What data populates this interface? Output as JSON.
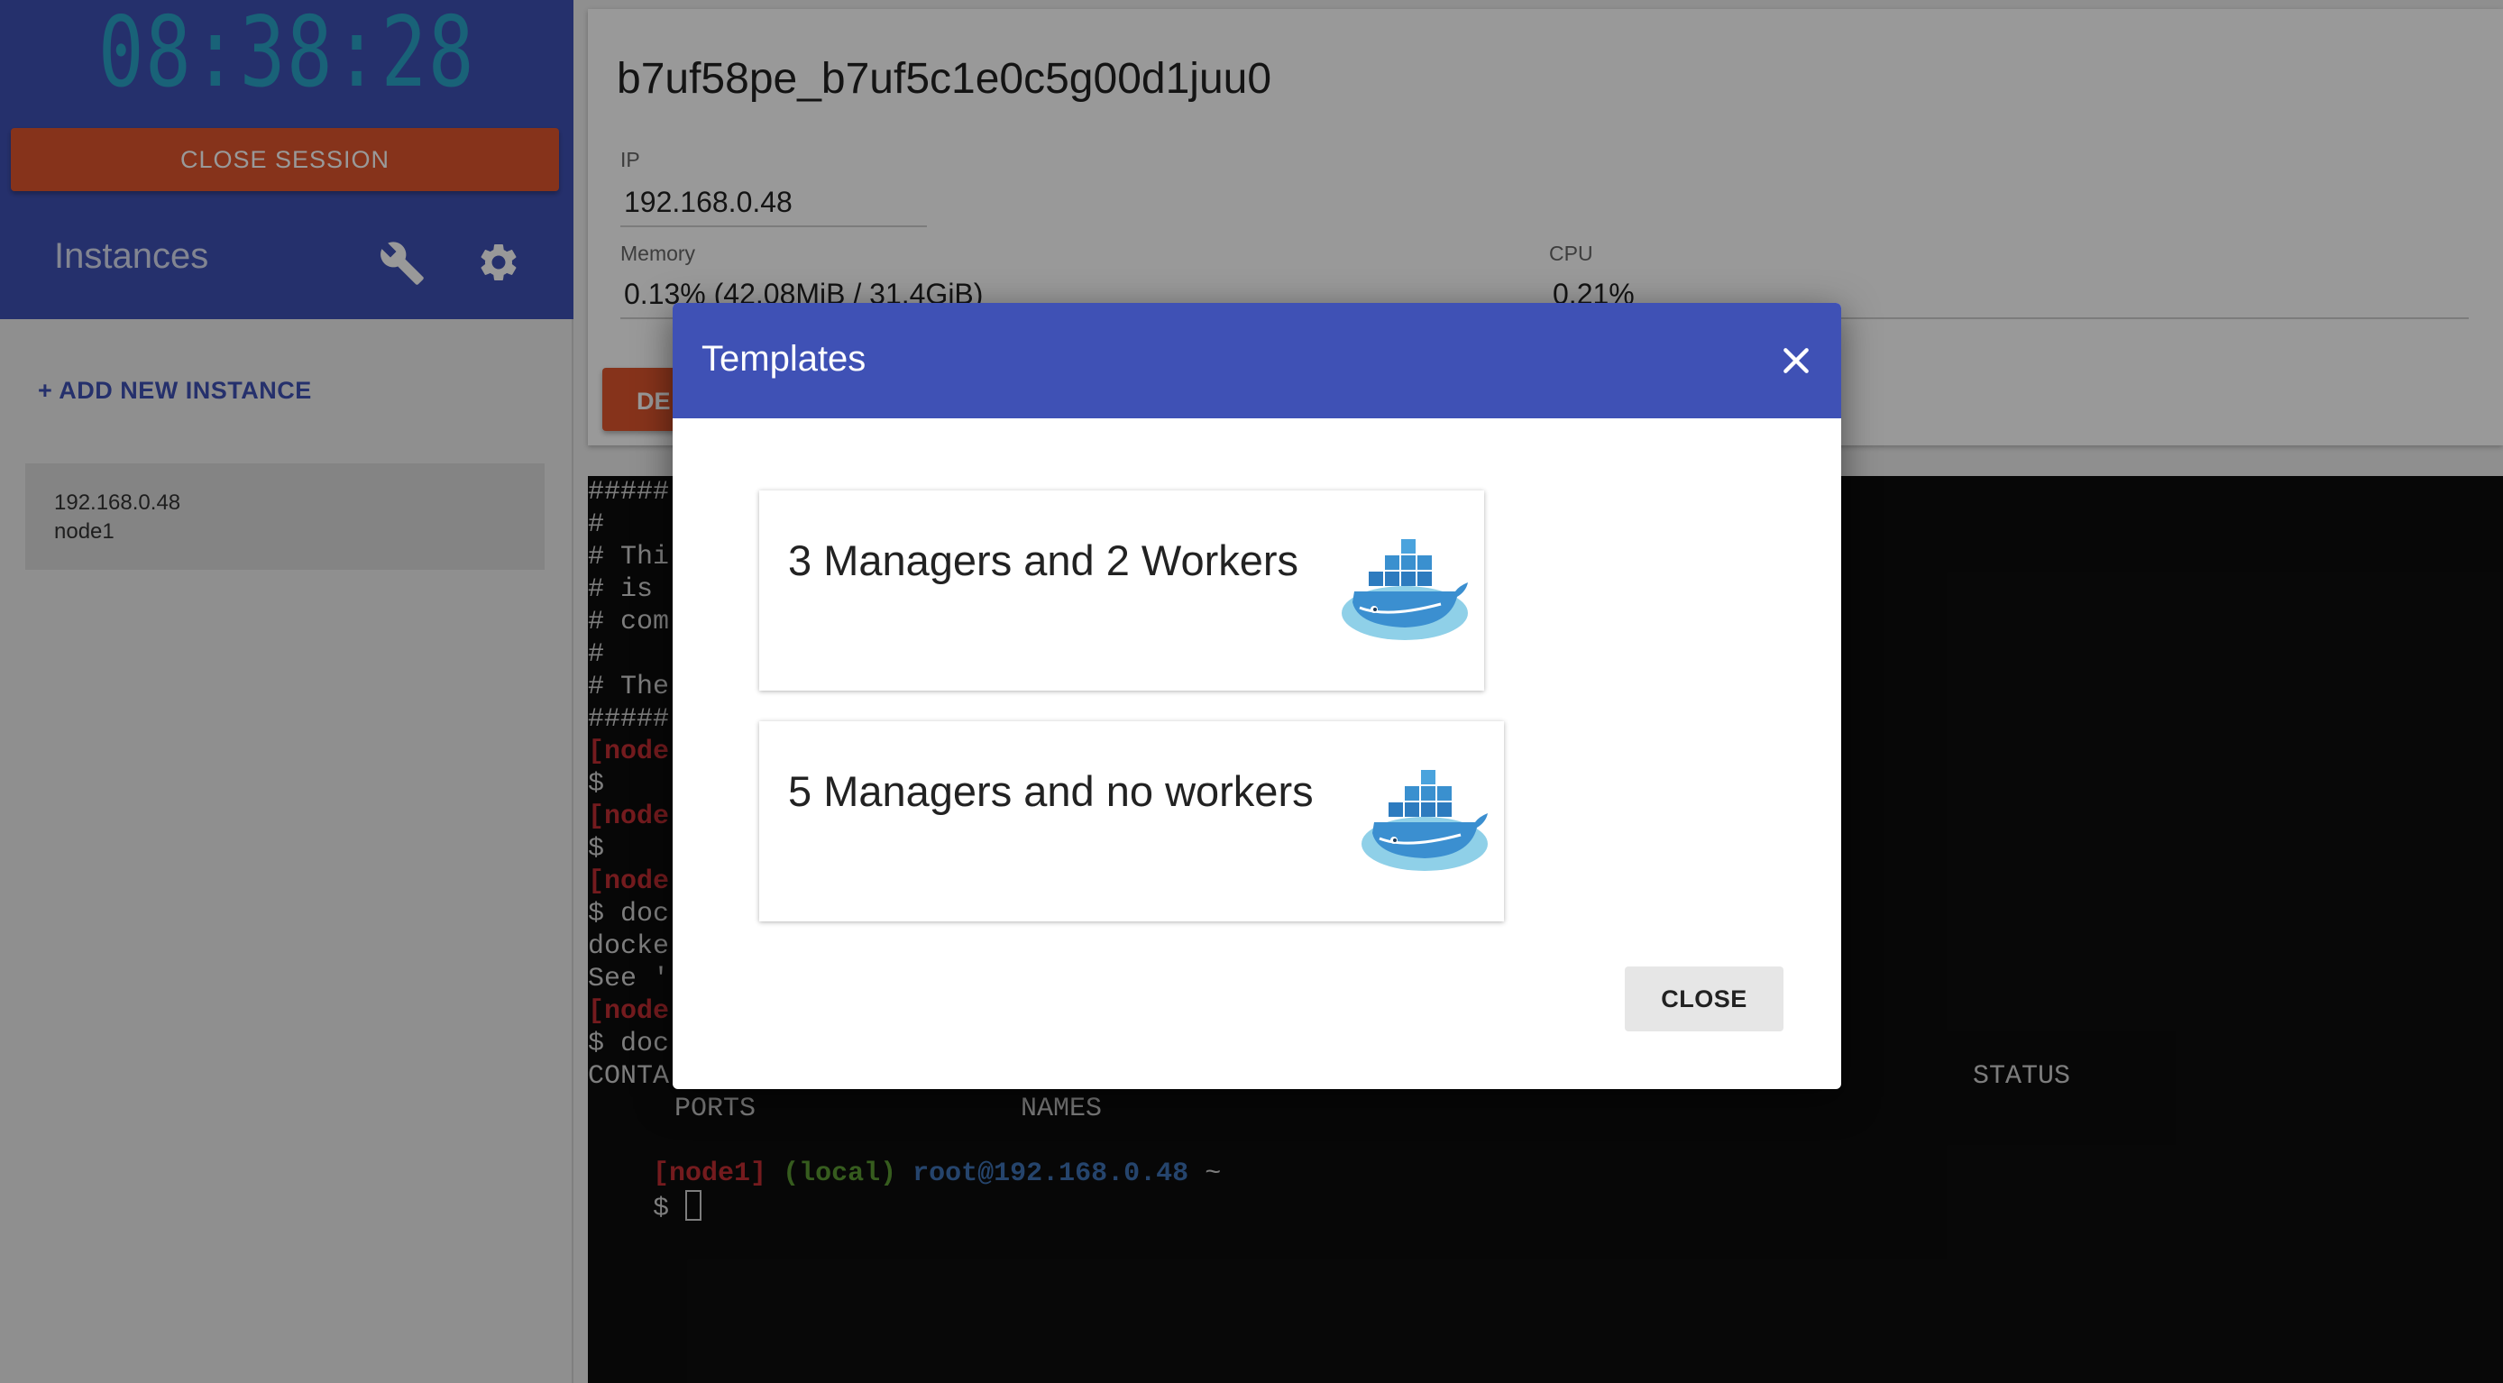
{
  "sidebar": {
    "clock": "08:38:28",
    "close_session_label": "CLOSE SESSION",
    "instances_title": "Instances",
    "add_instance_label": "+ ADD NEW INSTANCE",
    "instances": [
      {
        "ip": "192.168.0.48",
        "name": "node1"
      }
    ],
    "icons": [
      "wrench-icon",
      "gear-icon"
    ]
  },
  "instance_panel": {
    "title": "b7uf58pe_b7uf5c1e0c5g00d1juu0",
    "ip_label": "IP",
    "ip_value": "192.168.0.48",
    "memory_label": "Memory",
    "memory_value": "0.13% (42.08MiB / 31.4GiB)",
    "cpu_label": "CPU",
    "cpu_value": "0.21%",
    "delete_label_visible": "DE"
  },
  "terminal": {
    "lines": [
      "#####",
      "#",
      "# Thi",
      "# is",
      "# com",
      "#",
      "# The",
      "#####",
      "[node",
      "$",
      "[node",
      "$",
      "[node",
      "$ doc",
      "docke",
      "See '",
      "[node",
      "$ doc"
    ],
    "header_line_start": "CONTA",
    "header_status": "STATUS",
    "header_ports": "PORTS",
    "header_names": "NAMES",
    "prompt_host": "[node1]",
    "prompt_scope": "(local)",
    "prompt_user": "root@192.168.0.48",
    "prompt_dir": "~",
    "prompt_symbol": "$"
  },
  "modal": {
    "title": "Templates",
    "templates": [
      {
        "label": "3 Managers and 2 Workers",
        "icon": "docker-logo-icon"
      },
      {
        "label": "5 Managers and no workers",
        "icon": "docker-logo-icon"
      }
    ],
    "close_label": "CLOSE"
  },
  "colors": {
    "primary": "#3f51b5",
    "accent_red": "#e0552d",
    "clock": "#2aa3c8",
    "terminal_bg": "#0d0d0d",
    "prompt_red": "#c22e32",
    "prompt_green": "#5b9a32",
    "prompt_blue": "#3f72b5"
  }
}
